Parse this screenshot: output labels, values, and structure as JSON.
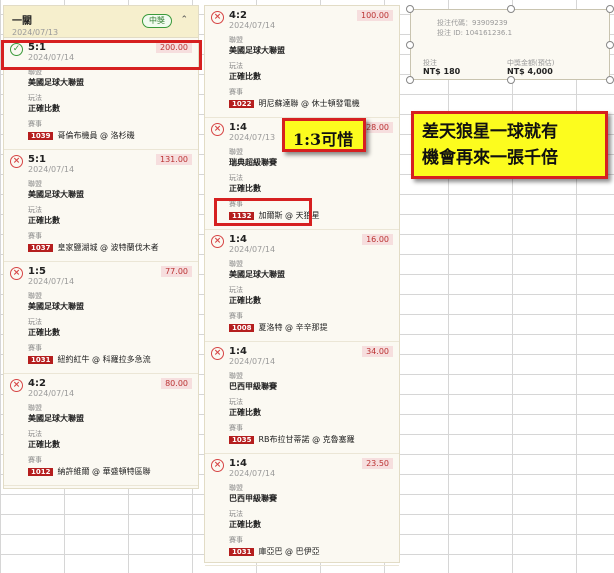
{
  "left_panel": {
    "header": {
      "title": "一關",
      "date": "2024/07/13",
      "status_badge": "中獎"
    },
    "bets": [
      {
        "score": "5:1",
        "date": "2024/07/14",
        "amount": "200.00",
        "status": "win",
        "league_label": "聯盟",
        "league": "美國足球大聯盟",
        "play_label": "玩法",
        "play": "正確比數",
        "match_label": "賽事",
        "match_id": "1039",
        "match": "哥倫布機員 @ 洛杉磯"
      },
      {
        "score": "5:1",
        "date": "2024/07/14",
        "amount": "131.00",
        "status": "lose",
        "league_label": "聯盟",
        "league": "美國足球大聯盟",
        "play_label": "玩法",
        "play": "正確比數",
        "match_label": "賽事",
        "match_id": "1037",
        "match": "皇家鹽湖城 @ 波特蘭伐木者"
      },
      {
        "score": "1:5",
        "date": "2024/07/14",
        "amount": "77.00",
        "status": "lose",
        "league_label": "聯盟",
        "league": "美國足球大聯盟",
        "play_label": "玩法",
        "play": "正確比數",
        "match_label": "賽事",
        "match_id": "1031",
        "match": "紐約紅牛 @ 科羅拉多急流"
      },
      {
        "score": "4:2",
        "date": "2024/07/14",
        "amount": "80.00",
        "status": "lose",
        "league_label": "聯盟",
        "league": "美國足球大聯盟",
        "play_label": "玩法",
        "play": "正確比數",
        "match_label": "賽事",
        "match_id": "1012",
        "match": "納許維爾 @ 華盛頓特區聯"
      }
    ]
  },
  "mid_panel": {
    "bets": [
      {
        "score": "4:2",
        "date": "2024/07/14",
        "amount": "100.00",
        "status": "lose",
        "league_label": "聯盟",
        "league": "美國足球大聯盟",
        "play_label": "玩法",
        "play": "正確比數",
        "match_label": "賽事",
        "match_id": "1022",
        "match": "明尼蘇達聯 @ 休士頓發電機"
      },
      {
        "score": "1:4",
        "date": "2024/07/13",
        "amount": "28.00",
        "status": "lose",
        "league_label": "聯盟",
        "league": "瑞典超級聯賽",
        "play_label": "玩法",
        "play": "正確比數",
        "match_label": "賽事",
        "match_id": "1132",
        "match": "加爾斯 @ 天狼星"
      },
      {
        "score": "1:4",
        "date": "2024/07/14",
        "amount": "16.00",
        "status": "lose",
        "league_label": "聯盟",
        "league": "美國足球大聯盟",
        "play_label": "玩法",
        "play": "正確比數",
        "match_label": "賽事",
        "match_id": "1008",
        "match": "夏洛特 @ 辛辛那提"
      },
      {
        "score": "1:4",
        "date": "2024/07/14",
        "amount": "34.00",
        "status": "lose",
        "league_label": "聯盟",
        "league": "巴西甲級聯賽",
        "play_label": "玩法",
        "play": "正確比數",
        "match_label": "賽事",
        "match_id": "1035",
        "match": "RB布拉甘蒂諾 @ 克魯塞羅"
      },
      {
        "score": "1:4",
        "date": "2024/07/14",
        "amount": "23.50",
        "status": "lose",
        "league_label": "聯盟",
        "league": "巴西甲級聯賽",
        "play_label": "玩法",
        "play": "正確比數",
        "match_label": "賽事",
        "match_id": "1031",
        "match": "庫亞巴 @ 巴伊亞"
      }
    ]
  },
  "info_box": {
    "code_line": "投注代碼：93909239",
    "id_line": "投注 ID: 104161236.1",
    "stake_label": "投注",
    "stake_value": "NT$ 180",
    "payout_label": "中獎金額(預估)",
    "payout_value": "NT$ 4,000"
  },
  "callouts": {
    "score_note": "1:3可惜",
    "main_note_line1": "差天狼星一球就有",
    "main_note_line2": "機會再來一張千倍"
  },
  "colors": {
    "accent_red": "#d62020",
    "callout_yellow": "#fcfc1e",
    "win_green": "#3b9a3b",
    "match_badge": "#b51e1e"
  }
}
